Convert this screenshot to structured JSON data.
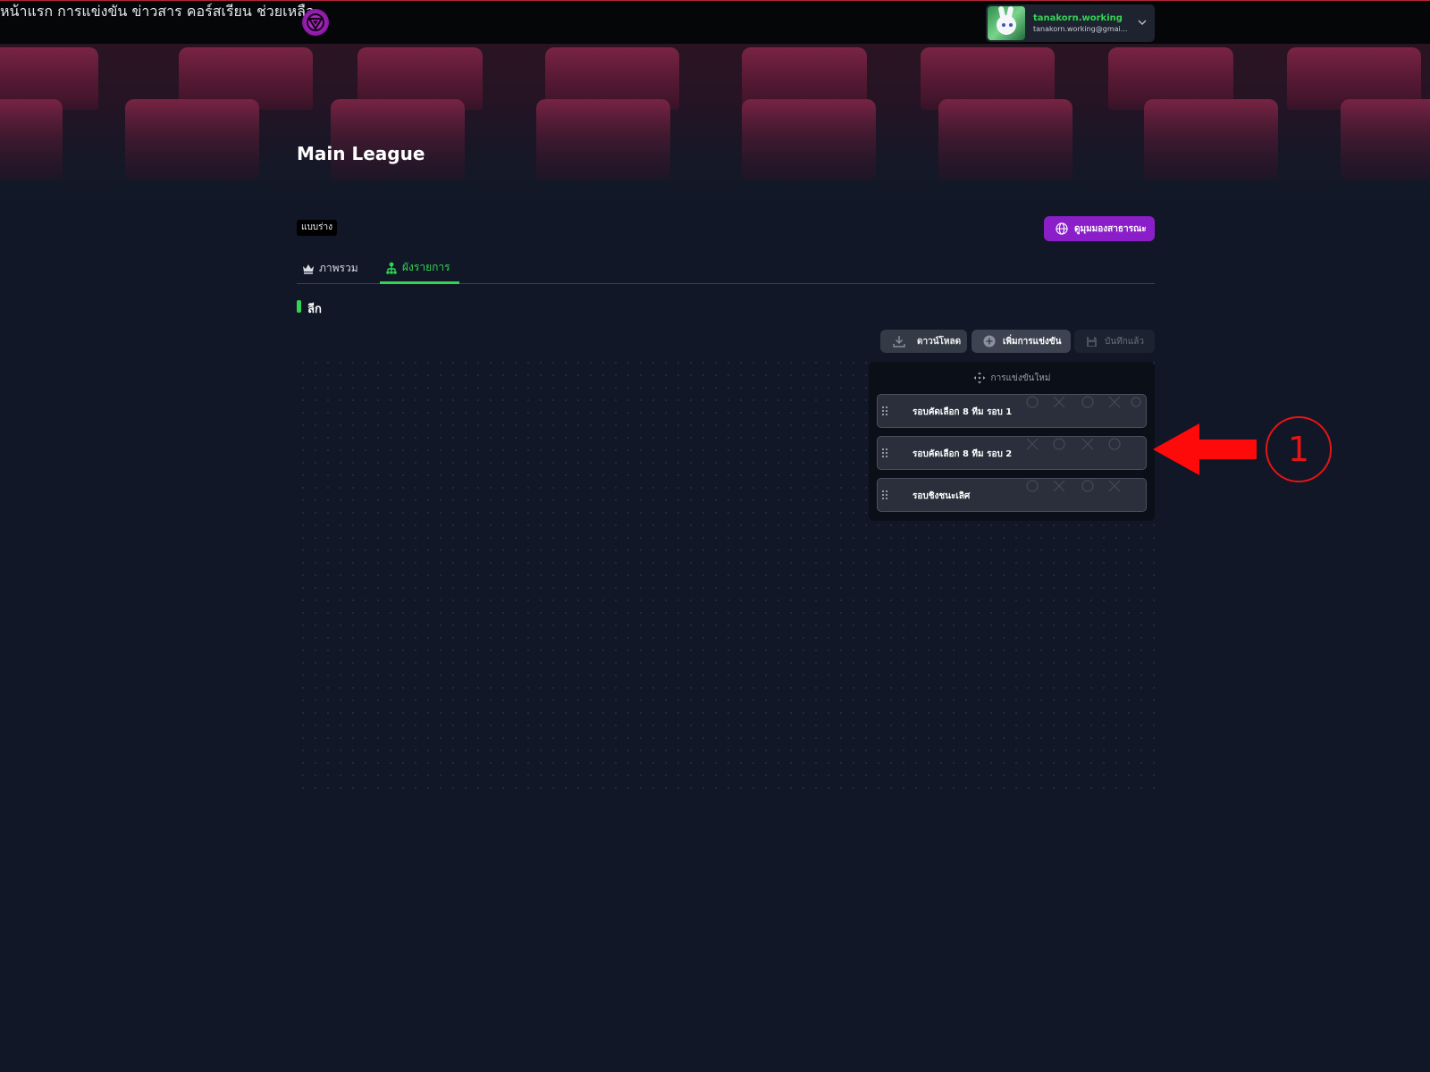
{
  "nav": {
    "items": [
      {
        "label": "หน้าแรก"
      },
      {
        "label": "การแข่งขัน"
      },
      {
        "label": "ข่าวสาร"
      },
      {
        "label": "คอร์สเรียน"
      },
      {
        "label": "ช่วยเหลือ"
      }
    ]
  },
  "user": {
    "name": "tanakorn.working",
    "email": "tanakorn.working@gmai..."
  },
  "page": {
    "title": "Main League",
    "status_badge": "แบบร่าง",
    "public_view_label": "ดูมุมมองสาธารณะ"
  },
  "tabs": [
    {
      "label": "ภาพรวม"
    },
    {
      "label": "ผังรายการ"
    }
  ],
  "section": {
    "title": "ลีก"
  },
  "toolbar": {
    "download_label": "ดาวน์โหลด",
    "add_label": "เพิ่มการแข่งขัน",
    "saved_label": "บันทึกแล้ว"
  },
  "panel": {
    "header": "การแข่งขันใหม่",
    "stages": [
      {
        "label": "รอบคัดเลือก 8 ทีม รอบ 1"
      },
      {
        "label": "รอบคัดเลือก 8 ทีม รอบ 2"
      },
      {
        "label": "รอบชิงชนะเลิศ"
      }
    ]
  },
  "annotation": {
    "number": "1"
  },
  "colors": {
    "accent_green": "#33d453",
    "brand_purple": "#8a1fc9",
    "background": "#111726",
    "annotation_red": "#e51515"
  }
}
